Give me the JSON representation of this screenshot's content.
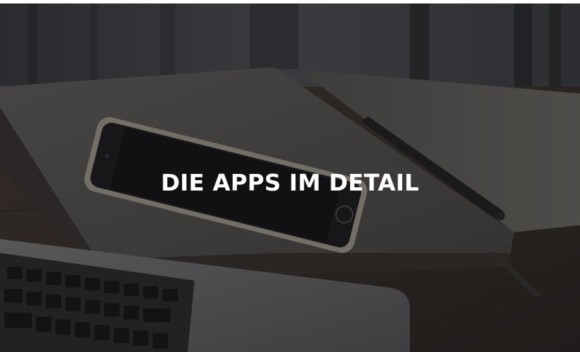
{
  "hero": {
    "title": "DIE APPS IM DETAIL",
    "background_image": "desk-with-notebook-smartphone-laptop-photo"
  },
  "colors": {
    "title_text": "#ffffff",
    "overlay": "#141416"
  }
}
